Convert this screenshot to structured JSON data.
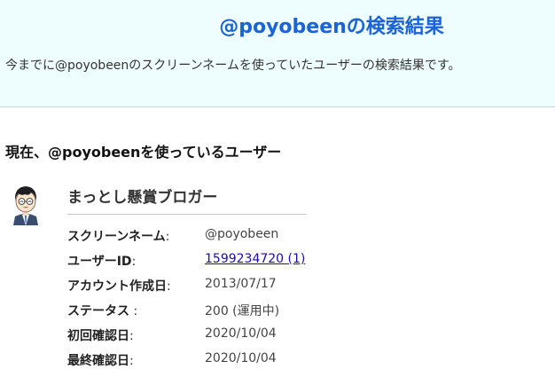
{
  "header": {
    "title": "@poyobeenの検索結果",
    "description": "今までに@poyobeenのスクリーンネームを使っていたユーザーの検索結果です。"
  },
  "current_users": {
    "section_title": "現在、@poyobeenを使っているユーザー",
    "user": {
      "avatar_icon": "cartoon-boy-avatar",
      "display_name": "まっとし懸賞ブロガー",
      "fields": [
        {
          "label": "スクリーンネーム",
          "colon": ":",
          "value": "@poyobeen"
        },
        {
          "label": "ユーザーID",
          "colon": ":",
          "value": "1599234720 (1)"
        },
        {
          "label": "アカウント作成日",
          "colon": ":",
          "value": "2013/07/17"
        },
        {
          "label": "ステータス",
          "colon": " :",
          "value": "200 (運用中)"
        },
        {
          "label": "初回確認日",
          "colon": ":",
          "value": "2020/10/04"
        },
        {
          "label": "最終確認日",
          "colon": ":",
          "value": "2020/10/04"
        }
      ]
    }
  },
  "colors": {
    "title": "#1b63d6",
    "header_bg": "#eefdfd",
    "link": "#1a0dab"
  }
}
